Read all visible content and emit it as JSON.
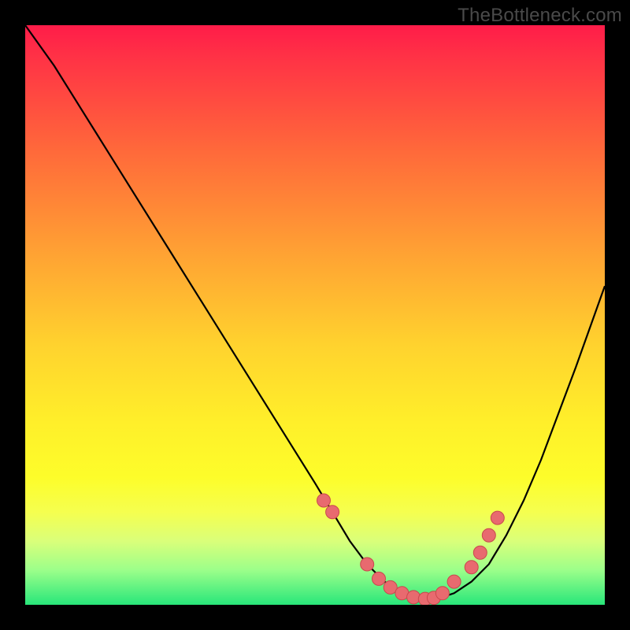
{
  "watermark": "TheBottleneck.com",
  "colors": {
    "background": "#000000",
    "curve": "#000000",
    "marker_fill": "#e86a6f",
    "marker_stroke": "#c9484d"
  },
  "chart_data": {
    "type": "line",
    "title": "",
    "xlabel": "",
    "ylabel": "",
    "xlim": [
      0,
      100
    ],
    "ylim": [
      0,
      100
    ],
    "series": [
      {
        "name": "bottleneck-curve",
        "x": [
          0,
          5,
          10,
          15,
          20,
          25,
          30,
          35,
          40,
          45,
          50,
          53,
          56,
          59,
          62,
          65,
          68,
          71,
          74,
          77,
          80,
          83,
          86,
          89,
          92,
          95,
          100
        ],
        "y": [
          100,
          93,
          85,
          77,
          69,
          61,
          53,
          45,
          37,
          29,
          21,
          16,
          11,
          7,
          4,
          2,
          1,
          1,
          2,
          4,
          7,
          12,
          18,
          25,
          33,
          41,
          55
        ]
      }
    ],
    "markers": {
      "name": "highlight-points",
      "x": [
        51.5,
        53,
        59,
        61,
        63,
        65,
        67,
        69,
        70.5,
        72,
        74,
        77,
        78.5,
        80,
        81.5
      ],
      "y": [
        18,
        16,
        7,
        4.5,
        3,
        2,
        1.3,
        1,
        1.2,
        2,
        4,
        6.5,
        9,
        12,
        15
      ]
    }
  }
}
